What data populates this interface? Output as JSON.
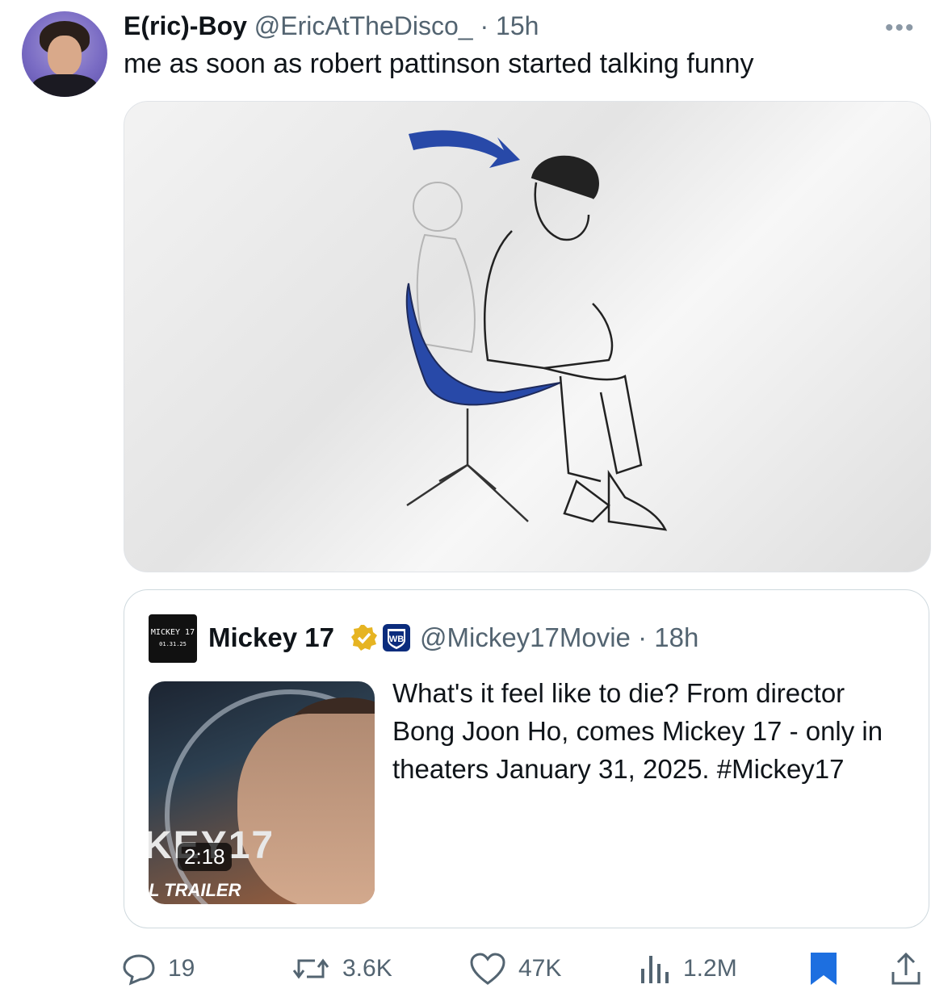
{
  "author": {
    "name": "E(ric)-Boy",
    "handle": "@EricAtTheDisco_",
    "time": "· 15h"
  },
  "more_label": "•••",
  "tweet_text": "me as soon as robert pattinson started talking funny",
  "quote": {
    "logo_text": "MICKEY 17",
    "logo_sub": "01.31.25",
    "name": "Mickey 17",
    "handle": "@Mickey17Movie · 18h",
    "text": "What's it feel like to die? From director Bong Joon Ho, comes Mickey 17 - only in theaters January 31, 2025. #Mickey17",
    "thumb_title": "KEY17",
    "duration": "2:18",
    "thumb_caption": "L TRAILER"
  },
  "actions": {
    "replies": "19",
    "reposts": "3.6K",
    "likes": "47K",
    "views": "1.2M"
  },
  "colors": {
    "accent": "#1d9bf0",
    "bookmark": "#1d6fe0",
    "verified": "#e6b422",
    "chair": "#2849a8"
  }
}
